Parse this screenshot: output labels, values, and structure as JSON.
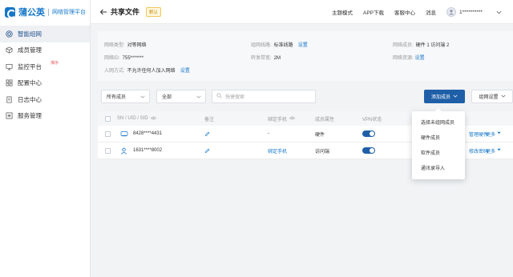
{
  "brand": {
    "name": "蒲公英",
    "subtitle": "网络管理平台"
  },
  "sidebar": {
    "items": [
      {
        "label": "智能组网",
        "icon": "network-icon",
        "active": true
      },
      {
        "label": "成员管理",
        "icon": "cube-icon",
        "active": false
      },
      {
        "label": "监控平台",
        "icon": "monitor-icon",
        "active": false,
        "badge": "演示"
      },
      {
        "label": "配置中心",
        "icon": "grid-icon",
        "active": false
      },
      {
        "label": "日志中心",
        "icon": "document-icon",
        "active": false
      },
      {
        "label": "服务管理",
        "icon": "list-icon",
        "active": false
      }
    ]
  },
  "header": {
    "title": "共享文件",
    "tag": "默认",
    "links": [
      "主题模式",
      "APP下载",
      "客服中心",
      "消息"
    ],
    "user": "1**********"
  },
  "info": {
    "type_label": "网络类型:",
    "type_value": "对等网络",
    "route_label": "组网线路:",
    "route_value": "标准线路",
    "route_link": "设置",
    "members_label": "网络成员:",
    "members_value": "硬件 1   访问端 2",
    "id_label": "网络ID:",
    "id_value": "755*******",
    "bandwidth_label": "转发带宽:",
    "bandwidth_value": "2M",
    "resources_label": "网络资源:",
    "resources_link": "设置",
    "join_label": "入网方式:",
    "join_value": "不允许任何人加入网络",
    "join_link": "设置"
  },
  "toolbar": {
    "filter_members": "所有成员",
    "filter_all": "全部",
    "search_placeholder": "快捷搜索",
    "add_member": "添加成员",
    "group_settings": "组网设置"
  },
  "table": {
    "headers": [
      "SN / UID / SID",
      "备注",
      "绑定手机",
      "成员属性",
      "VPN状态"
    ],
    "rows": [
      {
        "id": "8428****4431",
        "icon": "router-icon",
        "phone": "-",
        "type": "硬件",
        "vpn": true,
        "action1": "管理硬件",
        "more": "更多"
      },
      {
        "id": "1631****8002",
        "icon": "user-icon",
        "phone": "绑定手机",
        "type": "访问端",
        "vpn": true,
        "action1": "修改密码",
        "more": "更多"
      }
    ]
  },
  "dropdown": {
    "items": [
      "选择未组网成员",
      "硬件成员",
      "软件成员",
      "通讯录导入"
    ]
  },
  "colors": {
    "accent": "#1f5fa8",
    "link": "#1677c9",
    "badge": "#e34d4d"
  }
}
